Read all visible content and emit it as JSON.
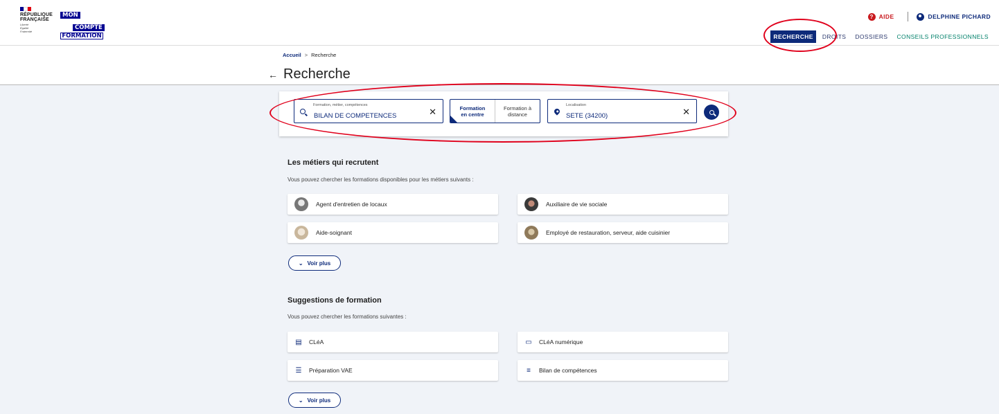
{
  "header": {
    "rf_lines": [
      "RÉPUBLIQUE",
      "FRANÇAISE"
    ],
    "rf_motto": [
      "Liberté",
      "Égalité",
      "Fraternité"
    ],
    "mcf_lines": [
      "MON",
      "COMPTE",
      "FORMATION"
    ],
    "aide_label": "AIDE",
    "aide_icon": "question-icon",
    "user_name": "DELPHINE PICHARD",
    "user_icon": "user-icon",
    "flag_colors": [
      "#000091",
      "#ffffff",
      "#e1000f"
    ]
  },
  "nav": {
    "items": [
      "RECHERCHE",
      "DROITS",
      "DOSSIERS",
      "CONSEILS PROFESSIONNELS"
    ],
    "active": "RECHERCHE"
  },
  "breadcrumb": {
    "home": "Accueil",
    "separator": ">",
    "current": "Recherche"
  },
  "page": {
    "title": "Recherche",
    "back_icon": "arrow-left-icon"
  },
  "search": {
    "what_label": "Formation, métier, compétences",
    "what_value": "BILAN DE COMPETENCES",
    "mode_on": "Formation en centre",
    "mode_off": "Formation à distance",
    "where_label": "Localisation",
    "where_value": "SETE (34200)",
    "clear_glyph": "✕"
  },
  "metiers": {
    "title": "Les métiers qui recrutent",
    "subtitle": "Vous pouvez chercher les formations disponibles pour les métiers suivants :",
    "items": [
      "Agent d'entretien de locaux",
      "Auxiliaire de vie sociale",
      "Aide-soignant",
      "Employé de restauration, serveur, aide cuisinier"
    ],
    "more": "Voir plus"
  },
  "suggestions": {
    "title": "Suggestions de formation",
    "subtitle": "Vous pouvez chercher les formations suivantes :",
    "items": [
      "CLéA",
      "CLéA numérique",
      "Préparation VAE",
      "Bilan de compétences"
    ],
    "icons": [
      "document-icon",
      "monitor-icon",
      "list-icon",
      "chart-icon"
    ],
    "more": "Voir plus"
  },
  "colors": {
    "brand": "#0d2a7a",
    "alert": "#c9191e",
    "annotation": "#e0001b",
    "teal": "#00806a"
  }
}
